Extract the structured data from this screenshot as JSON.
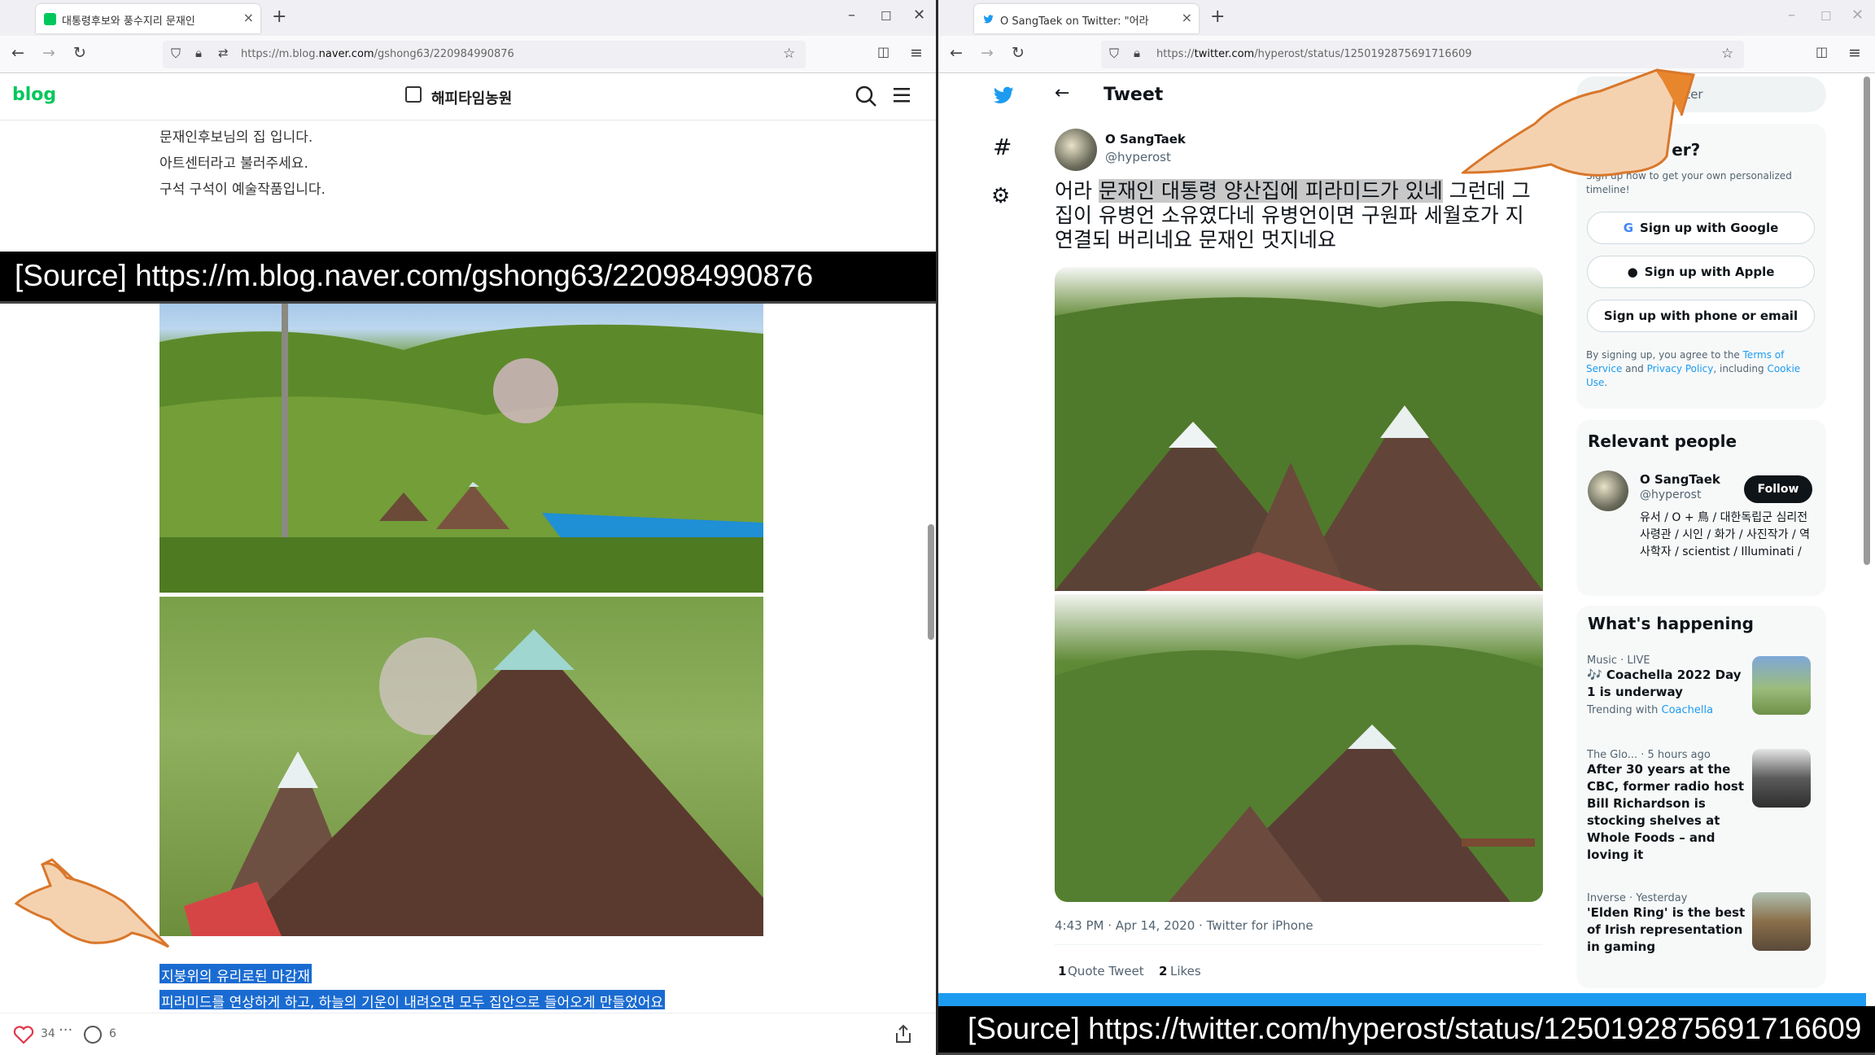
{
  "left_window": {
    "tab_title": "대통령후보와 풍수지리 문재인",
    "url_prefix": "https://m.blog.",
    "url_domain": "naver.com",
    "url_suffix": "/gshong63/220984990876",
    "blog_logo": "blog",
    "blog_title": "해피타임농원",
    "paragraphs": [
      "문재인후보님의 집 입니다.",
      "아트센터라고 불러주세요.",
      "구석 구석이 예술작품입니다."
    ],
    "highlight_1": "지붕위의 유리로된 마감재",
    "highlight_2": "피라미드를 연상하게 하고, 하늘의 기운이 내려오면 모두 집안으로 들어오게 만들었어요",
    "likes": "34",
    "comments": "6",
    "source_banner": "[Source]  https://m.blog.naver.com/gshong63/220984990876"
  },
  "right_window": {
    "tab_title": "O SangTaek on Twitter: \"어라",
    "url_prefix": "https://",
    "url_domain": "twitter.com",
    "url_suffix": "/hyperost/status/1250192875691716609",
    "page_title": "Tweet",
    "author_name": "O SangTaek",
    "author_handle": "@hyperost",
    "tweet_text_pre": "어라 ",
    "tweet_text_sel": "문재인 대통령 양산집에 피라미드가 있네",
    "tweet_text_post": " 그런데 그집이 유병언 소유였다네 유병언이면 구원파 세월호가 지 연결되 버리네요 문재인 멋지네요",
    "timestamp": "4:43 PM · Apr 14, 2020 · Twitter for iPhone",
    "quote_count": "1",
    "quote_label": "Quote Tweet",
    "like_count": "2",
    "like_label": "Likes",
    "search_placeholder": "witter",
    "signup": {
      "title": "w to T    er?",
      "subtitle": "Sign up now to get your own personalized timeline!",
      "google": "Sign up with Google",
      "apple": "Sign up with Apple",
      "email": "Sign up with phone or email",
      "terms_1": "By signing up, you agree to the ",
      "terms_link1": "Terms of Service",
      "terms_2": " and ",
      "terms_link2": "Privacy Policy",
      "terms_3": ", including ",
      "terms_link3": "Cookie Use",
      "terms_4": "."
    },
    "relevant": {
      "title": "Relevant people",
      "name": "O SangTaek",
      "handle": "@hyperost",
      "follow": "Follow",
      "bio": "유서 / O + 鳥 / 대한독립군 심리전 사령관 / 시인 / 화가 / 사진작가 / 역사학자 / scientist / Illuminati /"
    },
    "happening": {
      "title": "What's happening",
      "trends": [
        {
          "meta": "Music · LIVE",
          "headline": "🎶 Coachella 2022 Day 1 is underway",
          "extra_pre": "Trending with ",
          "extra_link": "Coachella"
        },
        {
          "meta": "The Glo... · 5 hours ago",
          "headline": "After 30 years at the CBC, former radio host Bill Richardson is stocking shelves at Whole Foods – and loving it"
        },
        {
          "meta": "Inverse · Yesterday",
          "headline": "'Elden Ring' is the best of Irish representation in gaming"
        }
      ]
    },
    "source_banner": "[Source]  https://twitter.com/hyperost/status/1250192875691716609"
  },
  "colors": {
    "naver_green": "#03c75a",
    "twitter_blue": "#1d9bf0",
    "highlight_blue": "#1a6bd1",
    "pointer_orange": "#d9772b"
  }
}
